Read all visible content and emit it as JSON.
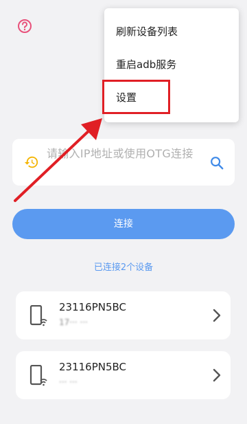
{
  "menu": {
    "items": [
      {
        "label": "刷新设备列表"
      },
      {
        "label": "重启adb服务"
      },
      {
        "label": "设置"
      }
    ]
  },
  "search": {
    "placeholder": "请输入IP地址或使用OTG连接"
  },
  "connect": {
    "label": "连接"
  },
  "devices": {
    "summary": "已连接2个设备",
    "items": [
      {
        "name": "23116PN5BC",
        "detail": "17··· ···"
      },
      {
        "name": "23116PN5BC",
        "detail": "··· ···"
      }
    ]
  },
  "colors": {
    "accent": "#5b9af0",
    "annotation": "#e01f25",
    "help_icon": "#e8517a",
    "history_icon": "#f4b400"
  }
}
